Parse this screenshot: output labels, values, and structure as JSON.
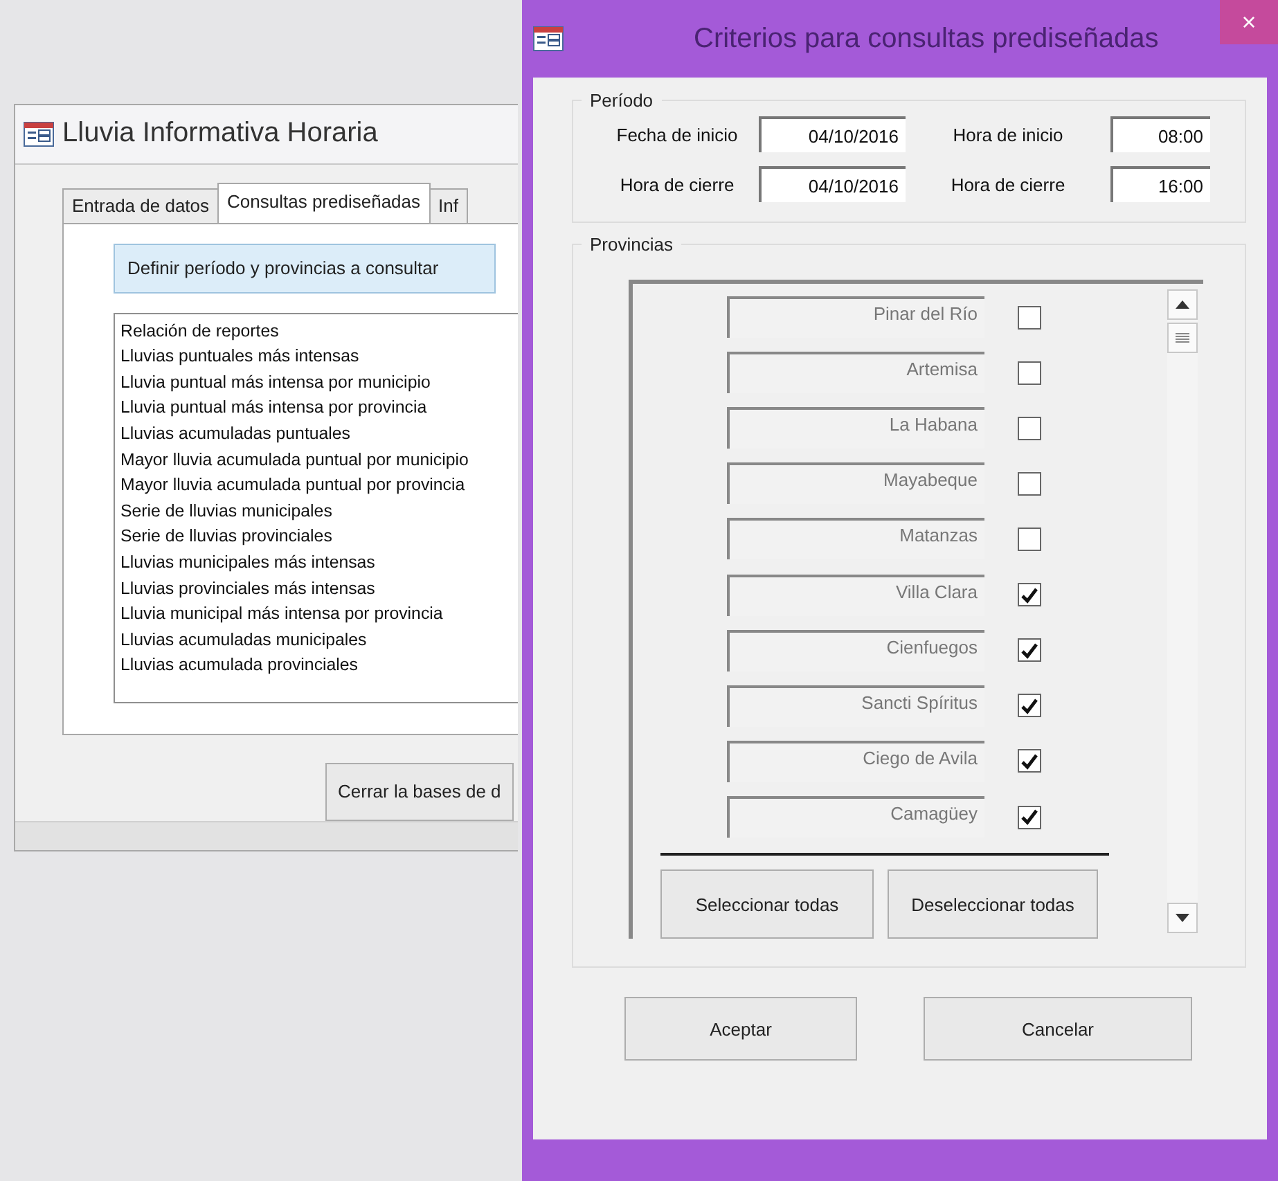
{
  "main_window": {
    "title": "Lluvia Informativa Horaria",
    "tabs": [
      {
        "label": "Entrada de datos",
        "selected": false
      },
      {
        "label": "Consultas prediseñadas",
        "selected": true
      },
      {
        "label": "Inf",
        "selected": false
      }
    ],
    "define_button": "Definir período y provincias a consultar",
    "reports": [
      "Relación de reportes",
      "Lluvias puntuales más intensas",
      "Lluvia puntual más intensa por municipio",
      "Lluvia puntual más intensa por provincia",
      "Lluvias acumuladas puntuales",
      "Mayor lluvia acumulada puntual por municipio",
      "Mayor lluvia acumulada puntual por provincia",
      "Serie de lluvias municipales",
      "Serie de lluvias provinciales",
      "Lluvias municipales más intensas",
      "Lluvias provinciales más intensas",
      "Lluvia municipal más intensa por provincia",
      "Lluvias acumuladas municipales",
      "Lluvias acumulada provinciales"
    ],
    "close_button": "Cerrar la bases de d"
  },
  "dialog": {
    "title": "Criterios para consultas prediseñadas",
    "close": "×",
    "period": {
      "legend": "Período",
      "fields": [
        {
          "label": "Fecha de inicio",
          "value": "04/10/2016"
        },
        {
          "label": "Hora de inicio",
          "value": "08:00"
        },
        {
          "label": "Hora de cierre",
          "value": "04/10/2016"
        },
        {
          "label": "Hora de cierre",
          "value": "16:00"
        }
      ]
    },
    "provinces": {
      "legend": "Provincias",
      "items": [
        {
          "name": "Pinar del Río",
          "checked": false
        },
        {
          "name": "Artemisa",
          "checked": false
        },
        {
          "name": "La Habana",
          "checked": false
        },
        {
          "name": "Mayabeque",
          "checked": false
        },
        {
          "name": "Matanzas",
          "checked": false
        },
        {
          "name": "Villa Clara",
          "checked": true
        },
        {
          "name": "Cienfuegos",
          "checked": true
        },
        {
          "name": "Sancti Spíritus",
          "checked": true
        },
        {
          "name": "Ciego de Avila",
          "checked": true
        },
        {
          "name": "Camagüey",
          "checked": true
        }
      ],
      "select_all": "Seleccionar todas",
      "deselect_all": "Deseleccionar todas"
    },
    "buttons": [
      "Aceptar",
      "Cancelar"
    ]
  }
}
